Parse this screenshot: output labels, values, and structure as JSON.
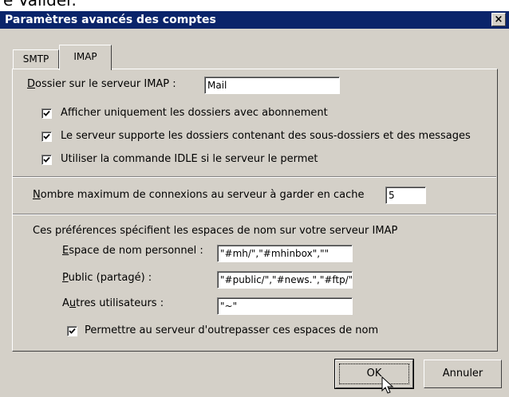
{
  "top_strip_text": "e Valider.",
  "window": {
    "title": "Paramètres avancés des comptes",
    "close_glyph": "×"
  },
  "tabs": [
    {
      "label": "SMTP"
    },
    {
      "label": "IMAP"
    }
  ],
  "imap": {
    "folder_label": "Dossier sur le serveur IMAP :",
    "folder_value": "Mail",
    "checkboxes": [
      {
        "label": "Afficher uniquement les dossiers avec abonnement",
        "checked": true
      },
      {
        "label": "Le serveur supporte les dossiers contenant des sous-dossiers et des messages",
        "checked": true
      },
      {
        "label": "Utiliser la commande IDLE si le serveur le permet",
        "checked": true
      }
    ],
    "max_conn_label": "Nombre maximum de connexions au serveur à garder en cache",
    "max_conn_value": "5",
    "ns_intro": "Ces préférences spécifient les espaces de nom sur votre serveur IMAP",
    "ns_personal_label": "Espace de nom personnel :",
    "ns_personal_value": "\"#mh/\",\"#mhinbox\",\"\"",
    "ns_public_label": "Public (partagé) :",
    "ns_public_value": "\"#public/\",\"#news.\",\"#ftp/\"",
    "ns_others_label": "Autres utilisateurs :",
    "ns_others_value": "\"~\"",
    "override_label": "Permettre au serveur d'outrepasser ces espaces de nom",
    "override_checked": true
  },
  "buttons": {
    "ok": "OK",
    "cancel": "Annuler"
  }
}
